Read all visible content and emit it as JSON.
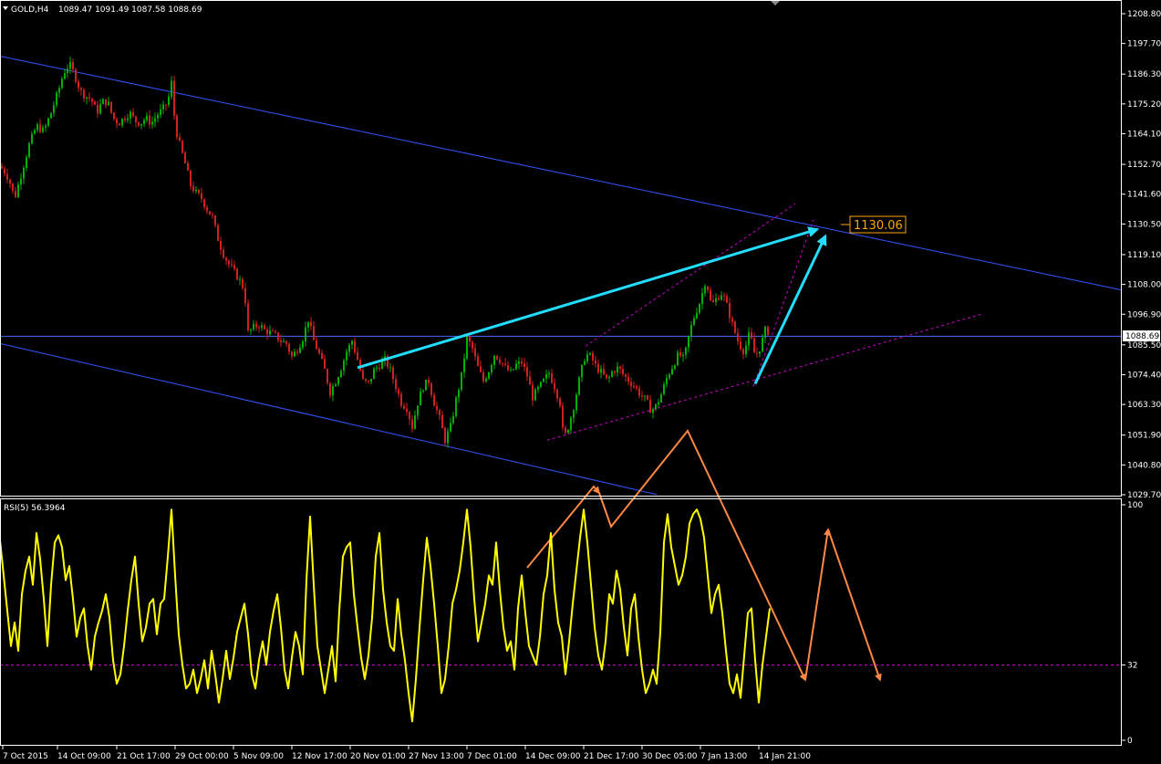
{
  "header": {
    "symbol": "GOLD,H4",
    "ohlc": "1089.47 1091.49 1087.58 1088.69",
    "rsi_label": "RSI(5) 56.3964"
  },
  "colors": {
    "background": "#000000",
    "frame": "#ffffff",
    "bull": "#00b000",
    "bear": "#d02020",
    "trend": "#3355ff",
    "hline": "#4466ff",
    "dashed": "#cc00cc",
    "cyan": "#22ddff",
    "orange": "#ff8844",
    "rsi": "#ffff00",
    "price_tag": "#ffa500"
  },
  "chart_data": [
    {
      "type": "candlestick",
      "title": "GOLD,H4",
      "ylim": [
        1029.7,
        1208.8
      ],
      "yticks": [
        1208.8,
        1197.7,
        1186.3,
        1175.2,
        1164.1,
        1152.7,
        1141.6,
        1130.5,
        1119.1,
        1108.0,
        1096.9,
        1085.5,
        1074.4,
        1063.3,
        1051.9,
        1040.8,
        1029.7
      ],
      "ytick_labels": [
        "1208.80",
        "1197.70",
        "1186.30",
        "1175.20",
        "1164.10",
        "1152.70",
        "1141.60",
        "1130.50",
        "1119.10",
        "1108.00",
        "1096.90",
        "1085.50",
        "1074.40",
        "1063.30",
        "1051.90",
        "1040.80",
        "1029.70"
      ],
      "x_labels": [
        "7 Oct 2015",
        "14 Oct 09:00",
        "21 Oct 17:00",
        "29 Oct 00:00",
        "5 Nov 09:00",
        "12 Nov 17:00",
        "20 Nov 01:00",
        "27 Nov 13:00",
        "7 Dec 01:00",
        "14 Dec 09:00",
        "21 Dec 17:00",
        "30 Dec 05:00",
        "7 Jan 13:00",
        "14 Jan 21:00"
      ],
      "current_price": "1088.69",
      "target_price_label": "1130.06",
      "target_price": 1130.06,
      "price_path": [
        [
          0,
          1152
        ],
        [
          5,
          1150
        ],
        [
          10,
          1147
        ],
        [
          16,
          1140
        ],
        [
          24,
          1150
        ],
        [
          32,
          1160
        ],
        [
          40,
          1167
        ],
        [
          48,
          1165
        ],
        [
          56,
          1172
        ],
        [
          64,
          1180
        ],
        [
          70,
          1187
        ],
        [
          76,
          1190
        ],
        [
          82,
          1186
        ],
        [
          88,
          1180
        ],
        [
          94,
          1178
        ],
        [
          100,
          1177
        ],
        [
          106,
          1172
        ],
        [
          112,
          1176
        ],
        [
          118,
          1176
        ],
        [
          124,
          1170
        ],
        [
          130,
          1168
        ],
        [
          136,
          1170
        ],
        [
          142,
          1172
        ],
        [
          148,
          1169
        ],
        [
          154,
          1168
        ],
        [
          160,
          1170
        ],
        [
          166,
          1168
        ],
        [
          172,
          1171
        ],
        [
          178,
          1173
        ],
        [
          184,
          1176
        ],
        [
          188,
          1183
        ],
        [
          192,
          1167
        ],
        [
          197,
          1160
        ],
        [
          203,
          1153
        ],
        [
          209,
          1145
        ],
        [
          215,
          1142
        ],
        [
          221,
          1140
        ],
        [
          227,
          1136
        ],
        [
          233,
          1133
        ],
        [
          238,
          1126
        ],
        [
          244,
          1120
        ],
        [
          250,
          1116
        ],
        [
          256,
          1113
        ],
        [
          262,
          1110
        ],
        [
          268,
          1106
        ],
        [
          272,
          1090
        ],
        [
          278,
          1092
        ],
        [
          284,
          1093
        ],
        [
          290,
          1091
        ],
        [
          296,
          1090
        ],
        [
          302,
          1089
        ],
        [
          308,
          1087
        ],
        [
          314,
          1086
        ],
        [
          320,
          1081
        ],
        [
          326,
          1084
        ],
        [
          332,
          1088
        ],
        [
          338,
          1095
        ],
        [
          344,
          1087
        ],
        [
          350,
          1082
        ],
        [
          356,
          1076
        ],
        [
          362,
          1068
        ],
        [
          368,
          1072
        ],
        [
          374,
          1077
        ],
        [
          380,
          1083
        ],
        [
          386,
          1087
        ],
        [
          392,
          1080
        ],
        [
          398,
          1072
        ],
        [
          404,
          1071
        ],
        [
          410,
          1076
        ],
        [
          416,
          1078
        ],
        [
          422,
          1080
        ],
        [
          428,
          1076
        ],
        [
          434,
          1070
        ],
        [
          440,
          1064
        ],
        [
          446,
          1062
        ],
        [
          452,
          1055
        ],
        [
          458,
          1064
        ],
        [
          464,
          1070
        ],
        [
          470,
          1072
        ],
        [
          476,
          1064
        ],
        [
          482,
          1058
        ],
        [
          488,
          1050
        ],
        [
          494,
          1055
        ],
        [
          500,
          1065
        ],
        [
          506,
          1074
        ],
        [
          512,
          1088
        ],
        [
          518,
          1084
        ],
        [
          524,
          1077
        ],
        [
          530,
          1072
        ],
        [
          536,
          1076
        ],
        [
          542,
          1082
        ],
        [
          548,
          1080
        ],
        [
          554,
          1077
        ],
        [
          560,
          1075
        ],
        [
          566,
          1078
        ],
        [
          572,
          1079
        ],
        [
          578,
          1074
        ],
        [
          584,
          1066
        ],
        [
          590,
          1069
        ],
        [
          596,
          1072
        ],
        [
          602,
          1075
        ],
        [
          608,
          1070
        ],
        [
          614,
          1064
        ],
        [
          618,
          1050
        ],
        [
          624,
          1056
        ],
        [
          630,
          1064
        ],
        [
          636,
          1074
        ],
        [
          642,
          1082
        ],
        [
          648,
          1081
        ],
        [
          654,
          1077
        ],
        [
          660,
          1075
        ],
        [
          666,
          1072
        ],
        [
          672,
          1076
        ],
        [
          678,
          1077
        ],
        [
          684,
          1074
        ],
        [
          690,
          1072
        ],
        [
          696,
          1070
        ],
        [
          702,
          1067
        ],
        [
          708,
          1065
        ],
        [
          714,
          1061
        ],
        [
          720,
          1063
        ],
        [
          726,
          1068
        ],
        [
          732,
          1074
        ],
        [
          738,
          1078
        ],
        [
          744,
          1082
        ],
        [
          750,
          1080
        ],
        [
          756,
          1090
        ],
        [
          762,
          1097
        ],
        [
          768,
          1102
        ],
        [
          774,
          1110
        ],
        [
          780,
          1100
        ],
        [
          786,
          1103
        ],
        [
          792,
          1105
        ],
        [
          798,
          1099
        ],
        [
          804,
          1092
        ],
        [
          810,
          1086
        ],
        [
          816,
          1083
        ],
        [
          822,
          1090
        ],
        [
          828,
          1081
        ],
        [
          834,
          1085
        ],
        [
          840,
          1092
        ],
        [
          844,
          1089
        ]
      ]
    },
    {
      "type": "line",
      "title": "RSI(5) 56.3964",
      "ylim": [
        0,
        100
      ],
      "yticks": [
        100,
        32,
        0
      ],
      "ytick_labels": [
        "100",
        "32",
        "0"
      ],
      "level": 32,
      "values_path": [
        [
          0,
          85
        ],
        [
          4,
          70
        ],
        [
          8,
          55
        ],
        [
          12,
          40
        ],
        [
          16,
          50
        ],
        [
          20,
          38
        ],
        [
          24,
          62
        ],
        [
          28,
          72
        ],
        [
          32,
          78
        ],
        [
          36,
          66
        ],
        [
          40,
          88
        ],
        [
          44,
          77
        ],
        [
          48,
          60
        ],
        [
          52,
          40
        ],
        [
          56,
          66
        ],
        [
          60,
          84
        ],
        [
          64,
          87
        ],
        [
          68,
          82
        ],
        [
          72,
          68
        ],
        [
          76,
          74
        ],
        [
          80,
          60
        ],
        [
          84,
          44
        ],
        [
          88,
          52
        ],
        [
          92,
          56
        ],
        [
          96,
          40
        ],
        [
          100,
          30
        ],
        [
          104,
          44
        ],
        [
          108,
          50
        ],
        [
          112,
          55
        ],
        [
          116,
          62
        ],
        [
          120,
          52
        ],
        [
          124,
          34
        ],
        [
          128,
          24
        ],
        [
          132,
          28
        ],
        [
          136,
          40
        ],
        [
          140,
          55
        ],
        [
          144,
          68
        ],
        [
          148,
          78
        ],
        [
          152,
          58
        ],
        [
          156,
          42
        ],
        [
          160,
          48
        ],
        [
          164,
          58
        ],
        [
          168,
          60
        ],
        [
          172,
          45
        ],
        [
          176,
          58
        ],
        [
          180,
          60
        ],
        [
          184,
          78
        ],
        [
          188,
          98
        ],
        [
          192,
          70
        ],
        [
          196,
          45
        ],
        [
          200,
          32
        ],
        [
          204,
          22
        ],
        [
          208,
          24
        ],
        [
          212,
          30
        ],
        [
          216,
          20
        ],
        [
          220,
          26
        ],
        [
          224,
          34
        ],
        [
          228,
          22
        ],
        [
          232,
          38
        ],
        [
          236,
          28
        ],
        [
          240,
          16
        ],
        [
          244,
          26
        ],
        [
          248,
          38
        ],
        [
          252,
          26
        ],
        [
          256,
          35
        ],
        [
          260,
          46
        ],
        [
          264,
          52
        ],
        [
          268,
          58
        ],
        [
          272,
          45
        ],
        [
          276,
          28
        ],
        [
          280,
          22
        ],
        [
          284,
          34
        ],
        [
          288,
          42
        ],
        [
          292,
          32
        ],
        [
          296,
          46
        ],
        [
          300,
          55
        ],
        [
          304,
          62
        ],
        [
          308,
          48
        ],
        [
          312,
          30
        ],
        [
          316,
          22
        ],
        [
          320,
          35
        ],
        [
          324,
          46
        ],
        [
          328,
          40
        ],
        [
          332,
          28
        ],
        [
          336,
          68
        ],
        [
          340,
          95
        ],
        [
          344,
          66
        ],
        [
          348,
          40
        ],
        [
          352,
          30
        ],
        [
          356,
          20
        ],
        [
          360,
          30
        ],
        [
          364,
          40
        ],
        [
          368,
          25
        ],
        [
          372,
          55
        ],
        [
          376,
          78
        ],
        [
          380,
          82
        ],
        [
          384,
          84
        ],
        [
          388,
          62
        ],
        [
          392,
          48
        ],
        [
          396,
          35
        ],
        [
          400,
          26
        ],
        [
          404,
          36
        ],
        [
          408,
          52
        ],
        [
          412,
          78
        ],
        [
          416,
          88
        ],
        [
          420,
          64
        ],
        [
          424,
          50
        ],
        [
          428,
          40
        ],
        [
          432,
          38
        ],
        [
          436,
          60
        ],
        [
          440,
          45
        ],
        [
          444,
          34
        ],
        [
          448,
          20
        ],
        [
          452,
          8
        ],
        [
          456,
          26
        ],
        [
          460,
          48
        ],
        [
          464,
          68
        ],
        [
          468,
          86
        ],
        [
          472,
          74
        ],
        [
          476,
          58
        ],
        [
          480,
          40
        ],
        [
          484,
          20
        ],
        [
          488,
          26
        ],
        [
          492,
          40
        ],
        [
          496,
          58
        ],
        [
          500,
          64
        ],
        [
          504,
          72
        ],
        [
          508,
          84
        ],
        [
          512,
          98
        ],
        [
          516,
          82
        ],
        [
          520,
          60
        ],
        [
          524,
          42
        ],
        [
          528,
          50
        ],
        [
          532,
          58
        ],
        [
          536,
          70
        ],
        [
          540,
          66
        ],
        [
          544,
          84
        ],
        [
          548,
          64
        ],
        [
          552,
          48
        ],
        [
          556,
          38
        ],
        [
          560,
          42
        ],
        [
          564,
          30
        ],
        [
          568,
          56
        ],
        [
          572,
          70
        ],
        [
          576,
          54
        ],
        [
          580,
          40
        ],
        [
          584,
          36
        ],
        [
          588,
          32
        ],
        [
          592,
          44
        ],
        [
          596,
          62
        ],
        [
          600,
          70
        ],
        [
          604,
          88
        ],
        [
          608,
          64
        ],
        [
          612,
          50
        ],
        [
          616,
          44
        ],
        [
          620,
          28
        ],
        [
          624,
          42
        ],
        [
          628,
          58
        ],
        [
          632,
          72
        ],
        [
          636,
          86
        ],
        [
          640,
          98
        ],
        [
          644,
          84
        ],
        [
          648,
          66
        ],
        [
          652,
          48
        ],
        [
          656,
          36
        ],
        [
          660,
          30
        ],
        [
          664,
          42
        ],
        [
          668,
          62
        ],
        [
          672,
          58
        ],
        [
          676,
          72
        ],
        [
          680,
          64
        ],
        [
          684,
          48
        ],
        [
          688,
          36
        ],
        [
          692,
          56
        ],
        [
          696,
          62
        ],
        [
          700,
          44
        ],
        [
          704,
          30
        ],
        [
          708,
          20
        ],
        [
          712,
          24
        ],
        [
          716,
          30
        ],
        [
          720,
          24
        ],
        [
          724,
          46
        ],
        [
          728,
          84
        ],
        [
          732,
          96
        ],
        [
          736,
          82
        ],
        [
          740,
          74
        ],
        [
          744,
          66
        ],
        [
          748,
          70
        ],
        [
          752,
          78
        ],
        [
          756,
          92
        ],
        [
          760,
          96
        ],
        [
          764,
          98
        ],
        [
          768,
          94
        ],
        [
          772,
          86
        ],
        [
          776,
          70
        ],
        [
          780,
          54
        ],
        [
          784,
          62
        ],
        [
          788,
          66
        ],
        [
          792,
          54
        ],
        [
          796,
          38
        ],
        [
          800,
          24
        ],
        [
          804,
          20
        ],
        [
          808,
          28
        ],
        [
          812,
          18
        ],
        [
          816,
          36
        ],
        [
          820,
          54
        ],
        [
          824,
          56
        ],
        [
          828,
          34
        ],
        [
          832,
          16
        ],
        [
          836,
          32
        ],
        [
          840,
          44
        ],
        [
          844,
          56
        ]
      ]
    }
  ]
}
